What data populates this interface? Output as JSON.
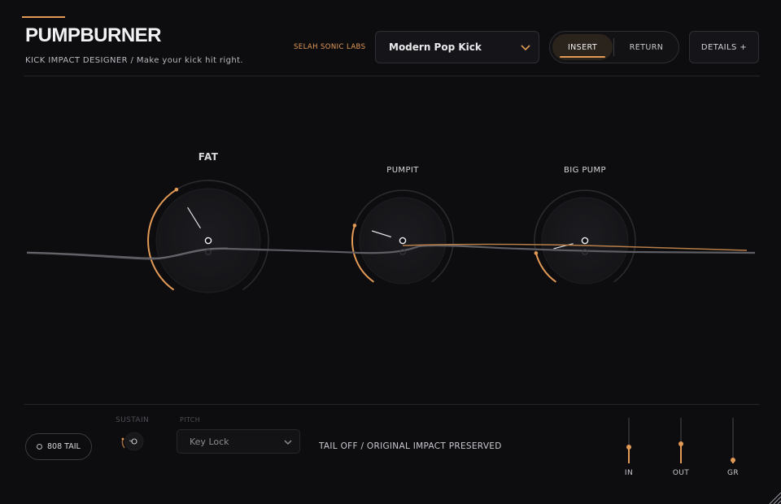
{
  "header": {
    "title": "PUMPBURNER",
    "subtitle": "KICK IMPACT DESIGNER / Make your kick hit right.",
    "brand": "SELAH SONIC LABS",
    "preset": {
      "value": "Modern Pop Kick",
      "icon": "chevron-down-icon"
    },
    "routing": {
      "options": [
        "INSERT",
        "RETURN"
      ],
      "selected": "INSERT"
    },
    "details_label": "DETAILS +"
  },
  "knobs": [
    {
      "label": "FAT",
      "value": 0.39
    },
    {
      "label": "PUMPIT",
      "value": 0.25
    },
    {
      "label": "BIG PUMP",
      "value": 0.14
    }
  ],
  "footer": {
    "tail_label": "808 TAIL",
    "sustain_label": "SUSTAIN",
    "pitch_label": "PITCH",
    "pitch_value": "Key Lock",
    "status": "TAIL OFF / ORIGINAL IMPACT PRESERVED",
    "meters": [
      {
        "label": "IN",
        "level": 0.36
      },
      {
        "label": "OUT",
        "level": 0.43
      },
      {
        "label": "GR",
        "level": 0.07
      }
    ]
  },
  "colors": {
    "accent": "#e39a55",
    "background": "#0d0d10",
    "knob": "#19191c"
  }
}
